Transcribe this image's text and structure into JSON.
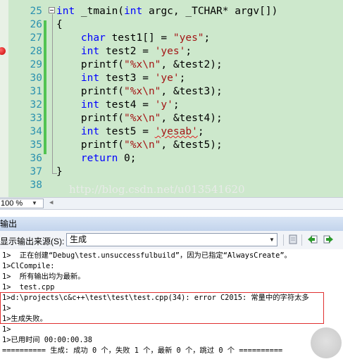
{
  "editor": {
    "line_numbers": [
      "25",
      "26",
      "27",
      "28",
      "29",
      "30",
      "31",
      "32",
      "33",
      "34",
      "35",
      "36",
      "37",
      "38"
    ],
    "lines": [
      [
        {
          "t": "int",
          "c": "kw"
        },
        {
          "t": " _tmain(",
          "c": ""
        },
        {
          "t": "int",
          "c": "kw"
        },
        {
          "t": " argc, _TCHAR* argv[])",
          "c": ""
        }
      ],
      [
        {
          "t": "{",
          "c": ""
        }
      ],
      [
        {
          "t": "    ",
          "c": ""
        },
        {
          "t": "char",
          "c": "kw"
        },
        {
          "t": " test1[] = ",
          "c": ""
        },
        {
          "t": "\"yes\"",
          "c": "str"
        },
        {
          "t": ";",
          "c": ""
        }
      ],
      [
        {
          "t": "    ",
          "c": ""
        },
        {
          "t": "int",
          "c": "kw"
        },
        {
          "t": " test2 = ",
          "c": ""
        },
        {
          "t": "'yes'",
          "c": "str"
        },
        {
          "t": ";",
          "c": ""
        }
      ],
      [
        {
          "t": "    printf(",
          "c": ""
        },
        {
          "t": "\"%x\\n\"",
          "c": "str"
        },
        {
          "t": ", &test2);",
          "c": ""
        }
      ],
      [
        {
          "t": "    ",
          "c": ""
        },
        {
          "t": "int",
          "c": "kw"
        },
        {
          "t": " test3 = ",
          "c": ""
        },
        {
          "t": "'ye'",
          "c": "str"
        },
        {
          "t": ";",
          "c": ""
        }
      ],
      [
        {
          "t": "    printf(",
          "c": ""
        },
        {
          "t": "\"%x\\n\"",
          "c": "str"
        },
        {
          "t": ", &test3);",
          "c": ""
        }
      ],
      [
        {
          "t": "    ",
          "c": ""
        },
        {
          "t": "int",
          "c": "kw"
        },
        {
          "t": " test4 = ",
          "c": ""
        },
        {
          "t": "'y'",
          "c": "str"
        },
        {
          "t": ";",
          "c": ""
        }
      ],
      [
        {
          "t": "    printf(",
          "c": ""
        },
        {
          "t": "\"%x\\n\"",
          "c": "str"
        },
        {
          "t": ", &test4);",
          "c": ""
        }
      ],
      [
        {
          "t": "    ",
          "c": ""
        },
        {
          "t": "int",
          "c": "kw"
        },
        {
          "t": " test5 = ",
          "c": ""
        },
        {
          "t": "'yesab'",
          "c": "str squig"
        },
        {
          "t": ";",
          "c": ""
        }
      ],
      [
        {
          "t": "    printf(",
          "c": ""
        },
        {
          "t": "\"%x\\n\"",
          "c": "str"
        },
        {
          "t": ", &test5);",
          "c": ""
        }
      ],
      [
        {
          "t": "    ",
          "c": ""
        },
        {
          "t": "return",
          "c": "kw"
        },
        {
          "t": " 0;",
          "c": ""
        }
      ],
      [
        {
          "t": "}",
          "c": ""
        }
      ],
      []
    ],
    "watermark": "http://blog.csdn.net/u013541620"
  },
  "zoom": {
    "value": "100 %"
  },
  "output_panel": {
    "title": "输出",
    "source_label": "显示输出来源(S):",
    "source_value": "生成",
    "lines": [
      "1>  正在创建“Debug\\test.unsuccessfulbuild”，因为已指定“AlwaysCreate”。",
      "1>ClCompile:",
      "1>  所有输出均为最新。",
      "1>  test.cpp",
      "1>d:\\projects\\c&c++\\test\\test\\test.cpp(34): error C2015: 常量中的字符太多",
      "1>",
      "1>生成失败。",
      "1>",
      "1>已用时间 00:00:00.38",
      "========== 生成: 成功 0 个，失败 1 个，最新 0 个，跳过 0 个 =========="
    ]
  },
  "colors": {
    "editor_bg": "#cde8cc",
    "keyword": "#0000ff",
    "string": "#a31515",
    "line_number": "#2b91af",
    "error_box": "#e03030",
    "breakpoint": "#c80000"
  }
}
